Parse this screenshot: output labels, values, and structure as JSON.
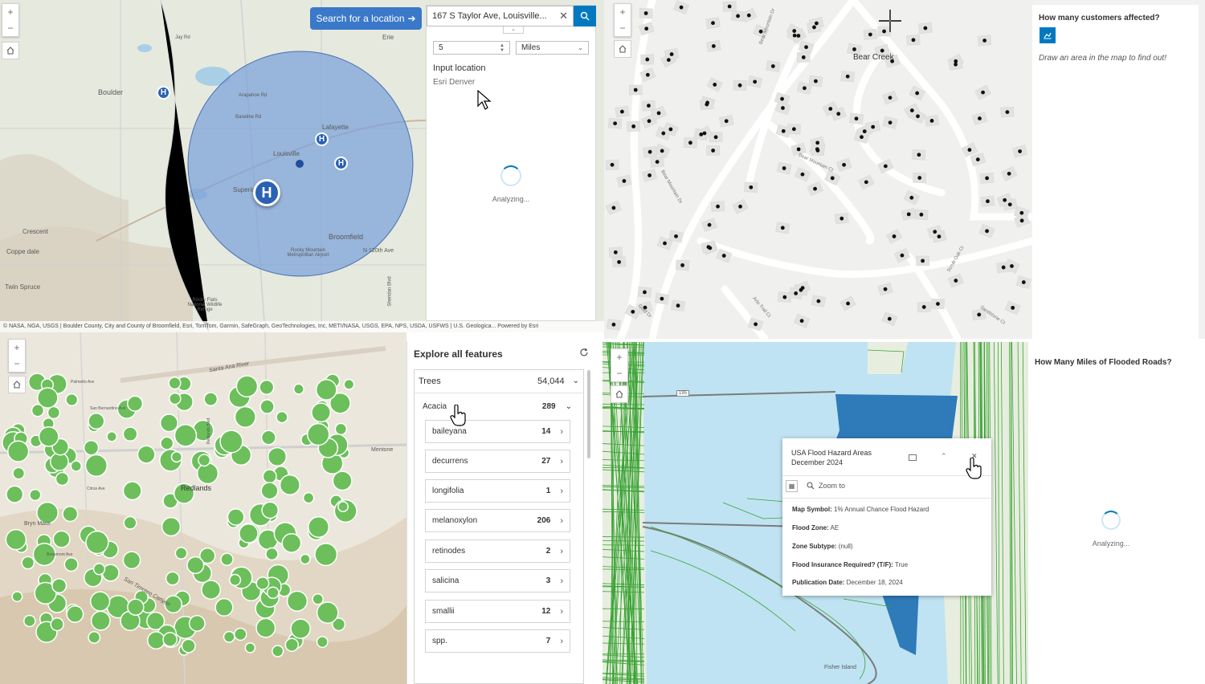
{
  "q1": {
    "search_button": "Search for a location",
    "address_value": "167 S Taylor Ave, Louisville...",
    "distance_value": "5",
    "units_value": "Miles",
    "input_location_label": "Input location",
    "input_location_value": "Esri Denver",
    "status": "Analyzing...",
    "map_labels": [
      "Boulder",
      "Louisville",
      "Lafayette",
      "Broomfield",
      "Superior",
      "Erie",
      "Crescent",
      "Coppe dale",
      "Twin Spruce",
      "Rocky Flats National Wildlife Refuge",
      "Rocky Mountain Metropolitan Airport",
      "N 120th Ave",
      "Baseline Rd",
      "Arapahoe Rd",
      "Jay Rd",
      "Sheridan Blvd"
    ],
    "attribution": "© NASA, NGA, USGS | Boulder County, City and County of Broomfield, Esri, TomTom, Garmin, SafeGraph, GeoTechnologies, Inc, METI/NASA, USGS, EPA, NPS, USDA, USFWS | U.S. Geologica...   Powered by Esri"
  },
  "q2": {
    "question": "How many customers affected?",
    "instruction": "Draw an area in the map to find out!",
    "map_labels": [
      "Bear Creek",
      "Bear Mountain Dr",
      "Bear Mountain Ct",
      "Bear Mountain Dr",
      "Scrub Oak Ct",
      "Sandstone Ct",
      "Arlo Trail Ct",
      "Gold Dr"
    ]
  },
  "q3": {
    "title": "Explore all features",
    "layer_name": "Trees",
    "layer_count": "54,044",
    "group_name": "Acacia",
    "group_count": "289",
    "items": [
      {
        "name": "baileyana",
        "count": "14"
      },
      {
        "name": "decurrens",
        "count": "27"
      },
      {
        "name": "longifolia",
        "count": "1"
      },
      {
        "name": "melanoxylon",
        "count": "206"
      },
      {
        "name": "retinodes",
        "count": "2"
      },
      {
        "name": "salicina",
        "count": "3"
      },
      {
        "name": "smallii",
        "count": "12"
      },
      {
        "name": "spp.",
        "count": "7"
      }
    ],
    "map_labels": [
      "Redlands",
      "Mentone",
      "Bryn Mawr",
      "Santa Ana River",
      "San Timoteo Canyon",
      "Palmetto Ave",
      "San Bernardino Ave",
      "Citrus Ave",
      "Redlands Blvd",
      "Beaumont Ave"
    ]
  },
  "q4": {
    "question": "How Many Miles of Flooded Roads?",
    "status": "Analyzing...",
    "popup": {
      "title_line1": "USA Flood Hazard Areas",
      "title_line2": "December 2024",
      "zoom_to": "Zoom to",
      "fields": [
        {
          "label": "Map Symbol:",
          "value": "1% Annual Chance Flood Hazard"
        },
        {
          "label": "Flood Zone:",
          "value": "AE"
        },
        {
          "label": "Zone Subtype:",
          "value": "(null)"
        },
        {
          "label": "Flood Insurance Required? (T/F):",
          "value": "True"
        },
        {
          "label": "Publication Date:",
          "value": "December 18, 2024"
        }
      ]
    },
    "map_labels": [
      "195",
      "Fisher Island"
    ]
  },
  "colors": {
    "accent": "#0079c1",
    "search_blue": "#3a78c9",
    "buffer_fill": "#7ea3d9",
    "tree_green": "#6cbf5b",
    "water": "#bfe3f2",
    "flood": "#2f7ab8",
    "roads": "#3aa335"
  }
}
